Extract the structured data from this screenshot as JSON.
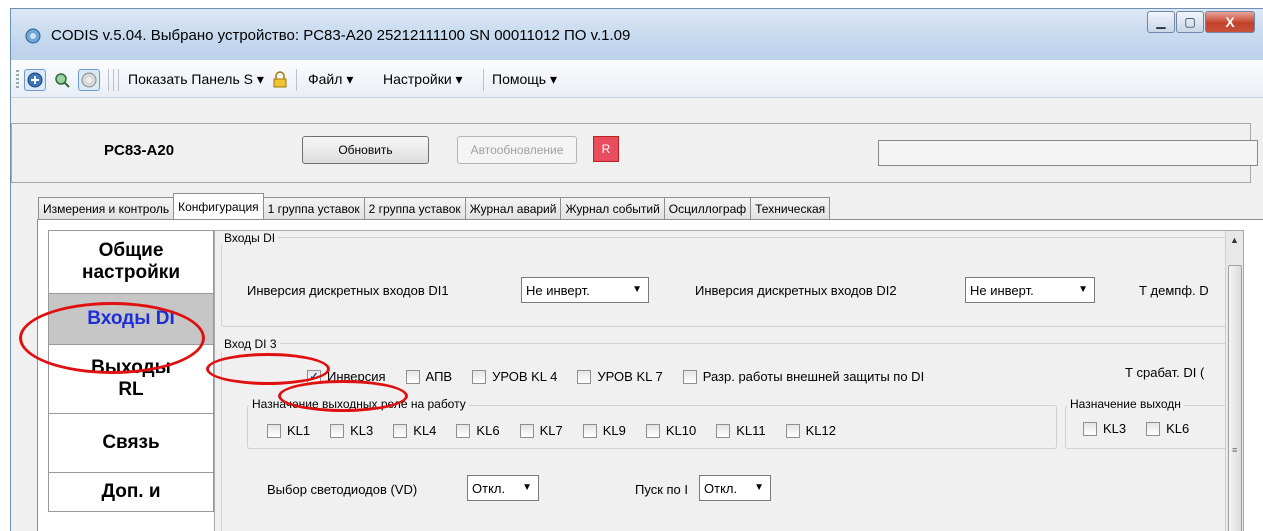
{
  "window": {
    "title": "CODIS v.5.04.  Выбрано устройство:  PC83-A20  25212111100  SN 00011012  ПО v.1.09",
    "controls": {
      "minimize": "▁",
      "maximize": "▢",
      "close": "X"
    }
  },
  "toolbar": {
    "icons": [
      "connect-icon",
      "search-icon",
      "disconnect-icon"
    ],
    "show_panel": "Показать Панель S",
    "file": "Файл",
    "settings": "Настройки",
    "help": "Помощь",
    "dropdown_arrow": "▾"
  },
  "device_bar": {
    "device_label": "PC83-A20",
    "refresh_label": "Обновить",
    "autorefresh_label": "Автообновление",
    "indicator_label": "R",
    "indicator_color": "#e94c5e"
  },
  "tabs": [
    {
      "label": "Измерения и контроль",
      "active": false
    },
    {
      "label": "Конфигурация",
      "active": true
    },
    {
      "label": "1 группа уставок",
      "active": false
    },
    {
      "label": "2 группа уставок",
      "active": false
    },
    {
      "label": "Журнал аварий",
      "active": false
    },
    {
      "label": "Журнал событий",
      "active": false
    },
    {
      "label": "Осциллограф",
      "active": false
    },
    {
      "label": "Техническая",
      "active": false
    }
  ],
  "leftnav": {
    "items": [
      {
        "label": "Общие настройки",
        "active": false
      },
      {
        "label": "Входы DI",
        "active": true
      },
      {
        "label": "Выходы RL",
        "active": false
      },
      {
        "label": "Связь",
        "active": false
      },
      {
        "label": "Доп. и",
        "active": false
      }
    ]
  },
  "content": {
    "di_group_title": "Входы DI",
    "inv_di1_label": "Инверсия дискретных входов DI1",
    "inv_di1_value": "Не инверт.",
    "inv_di2_label": "Инверсия дискретных входов DI2",
    "inv_di2_value": "Не инверт.",
    "t_damp_label": "Т демпф. D",
    "di3_group_title": "Вход DI 3",
    "di3_checks": [
      {
        "label": "Инверсия",
        "checked": true
      },
      {
        "label": "АПВ",
        "checked": false
      },
      {
        "label": "УРОВ KL 4",
        "checked": false
      },
      {
        "label": "УРОВ KL 7",
        "checked": false
      },
      {
        "label": "Разр. работы внешней защиты по DI",
        "checked": false
      }
    ],
    "t_trip_label": "Т срабат. DI (",
    "relay_group_title": "Назначение выходных реле на работу",
    "relays": [
      "KL1",
      "KL3",
      "KL4",
      "KL6",
      "KL7",
      "KL9",
      "KL10",
      "KL11",
      "KL12"
    ],
    "relay_group2_title": "Назначение выходн",
    "relays2": [
      "KL3",
      "KL6"
    ],
    "vd_label": "Выбор светодиодов (VD)",
    "vd_value": "Откл.",
    "start_i_label": "Пуск по I",
    "start_i_value": "Откл.",
    "check_mark": "✓",
    "scroll_up": "▲",
    "scroll_grip": "≡"
  },
  "annotation_color": "#e01010"
}
